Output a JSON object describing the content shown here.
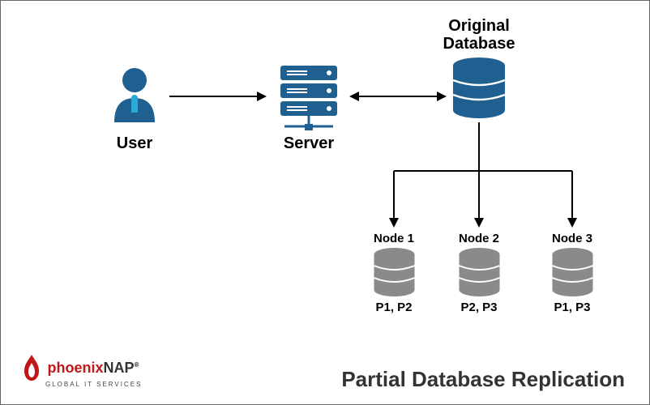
{
  "diagram": {
    "user_label": "User",
    "server_label": "Server",
    "original_db_label_line1": "Original",
    "original_db_label_line2": "Database",
    "nodes": [
      {
        "name": "Node 1",
        "parts": "P1, P2"
      },
      {
        "name": "Node 2",
        "parts": "P2, P3"
      },
      {
        "name": "Node 3",
        "parts": "P1, P3"
      }
    ],
    "caption": "Partial Database Replication"
  },
  "logo": {
    "brand_pre": "phoenix",
    "brand_post": "NAP",
    "tagline": "GLOBAL IT SERVICES"
  },
  "colors": {
    "blue": "#1f6091",
    "gray": "#8a8a8a",
    "tie": "#2aa8d6",
    "logo_red": "#c01818"
  }
}
